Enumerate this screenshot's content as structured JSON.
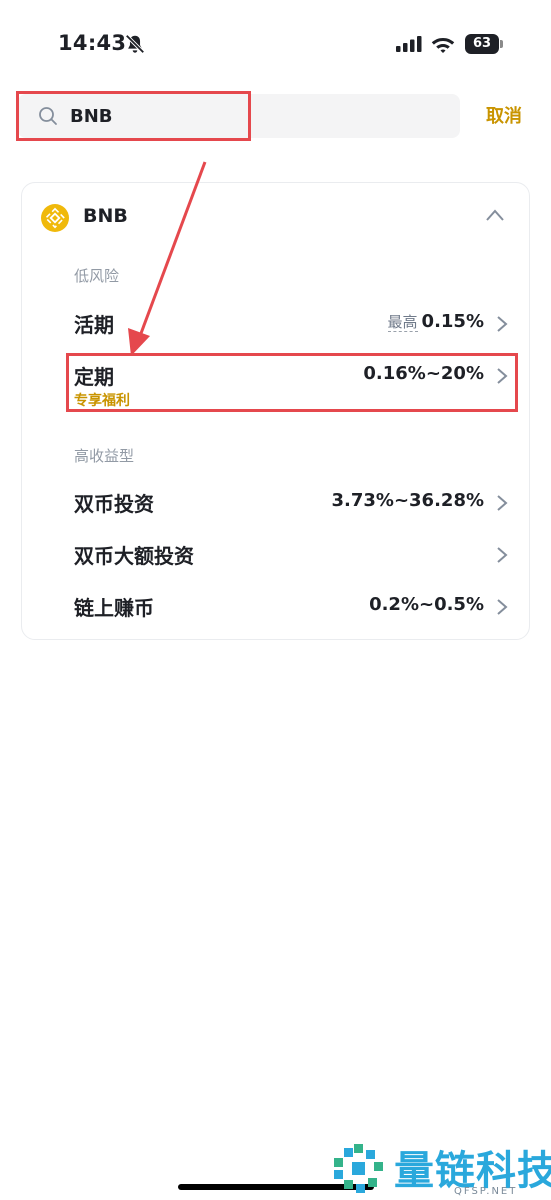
{
  "status_bar": {
    "time": "14:43",
    "battery": "63"
  },
  "search": {
    "value": "BNB",
    "cancel_label": "取消"
  },
  "card": {
    "coin": "BNB",
    "sections": [
      {
        "label": "低风险"
      },
      {
        "label": "高收益型"
      }
    ],
    "rows": [
      {
        "label": "活期",
        "prefix": "最高",
        "value": "0.15%"
      },
      {
        "label": "定期",
        "value": "0.16%~20%",
        "tag": "专享福利"
      },
      {
        "label": "双币投资",
        "value": "3.73%~36.28%"
      },
      {
        "label": "双币大额投资",
        "value": ""
      },
      {
        "label": "链上赚币",
        "value": "0.2%~0.5%"
      }
    ]
  },
  "watermark": {
    "title": "量链科技",
    "subtitle": "QFSP.NET"
  },
  "colors": {
    "accent": "#c99400",
    "annotation": "#e5484d",
    "coin": "#f0b90b"
  },
  "icons": [
    "bell-off-icon",
    "signal-icon",
    "wifi-icon",
    "battery-icon",
    "search-icon",
    "bnb-coin-icon",
    "chevron-up-icon",
    "chevron-right-icon"
  ]
}
